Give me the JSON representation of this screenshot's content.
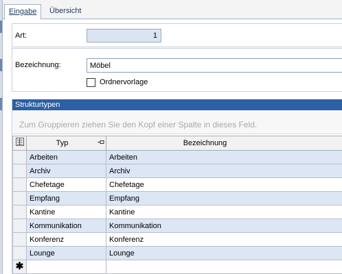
{
  "tabs": [
    {
      "label": "Eingabe",
      "active": true
    },
    {
      "label": "Übersicht",
      "active": false
    }
  ],
  "form": {
    "art": {
      "label": "Art:",
      "value": "1"
    },
    "bezeichnung": {
      "label": "Bezeichnung:",
      "value": "Möbel"
    },
    "ordnervorlage": {
      "label": "Ordnervorlage",
      "checked": false
    }
  },
  "grid": {
    "title": "Strukturtypen",
    "group_hint": "Zum Gruppieren ziehen Sie den Kopf einer Spalte in dieses Feld.",
    "columns": [
      "Typ",
      "Bezeichnung"
    ],
    "rows": [
      {
        "typ": "Arbeiten",
        "bezeichnung": "Arbeiten"
      },
      {
        "typ": "Archiv",
        "bezeichnung": "Archiv"
      },
      {
        "typ": "Chefetage",
        "bezeichnung": "Chefetage"
      },
      {
        "typ": "Empfang",
        "bezeichnung": "Empfang"
      },
      {
        "typ": "Kantine",
        "bezeichnung": "Kantine"
      },
      {
        "typ": "Kommunikation",
        "bezeichnung": "Kommunikation"
      },
      {
        "typ": "Konferenz",
        "bezeichnung": "Konferenz"
      },
      {
        "typ": "Lounge",
        "bezeichnung": "Lounge"
      }
    ],
    "new_row_symbol": "✱"
  },
  "icons": {
    "column_chooser": "column-chooser-icon",
    "pin": "pin-icon",
    "new_row": "new-row-icon"
  },
  "colors": {
    "header_bar": "#2c5fa3",
    "alt_row": "#dce6f4",
    "readonly_field": "#dbe4f1"
  }
}
